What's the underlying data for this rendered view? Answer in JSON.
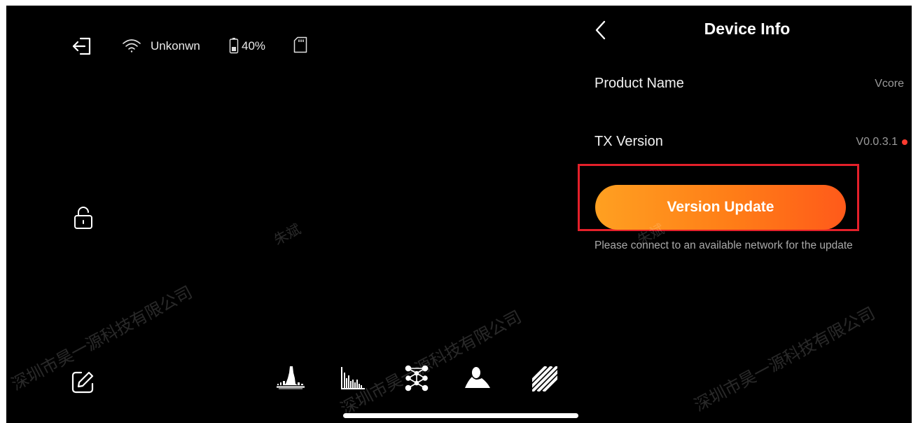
{
  "status_bar": {
    "wifi_label": "Unkonwn",
    "battery_label": "40%",
    "icons": [
      "exit-icon",
      "wifi-icon",
      "battery-icon",
      "sd-card-icon"
    ]
  },
  "left_tools": {
    "icons": [
      "unlock-icon",
      "edit-icon"
    ]
  },
  "bottom_toolbar": {
    "tools": [
      "waveform-icon",
      "histogram-icon",
      "network-icon",
      "silhouette-icon",
      "zebra-icon"
    ]
  },
  "panel": {
    "title": "Device Info",
    "back_icon": "chevron-left-icon",
    "rows": [
      {
        "label": "Product Name",
        "value": "Vcore"
      },
      {
        "label": "TX Version",
        "value": "V0.0.3.1",
        "indicator_color": "#ff3b2f"
      }
    ],
    "update_button": "Version Update",
    "update_note": "Please connect to an available network for the update"
  },
  "watermark": {
    "company": "深圳市昊一源科技有限公司",
    "name": "朱斌"
  },
  "colors": {
    "background": "#000000",
    "accent_start": "#ffa021",
    "accent_end": "#ff5a1a",
    "highlight": "#e4202a"
  }
}
